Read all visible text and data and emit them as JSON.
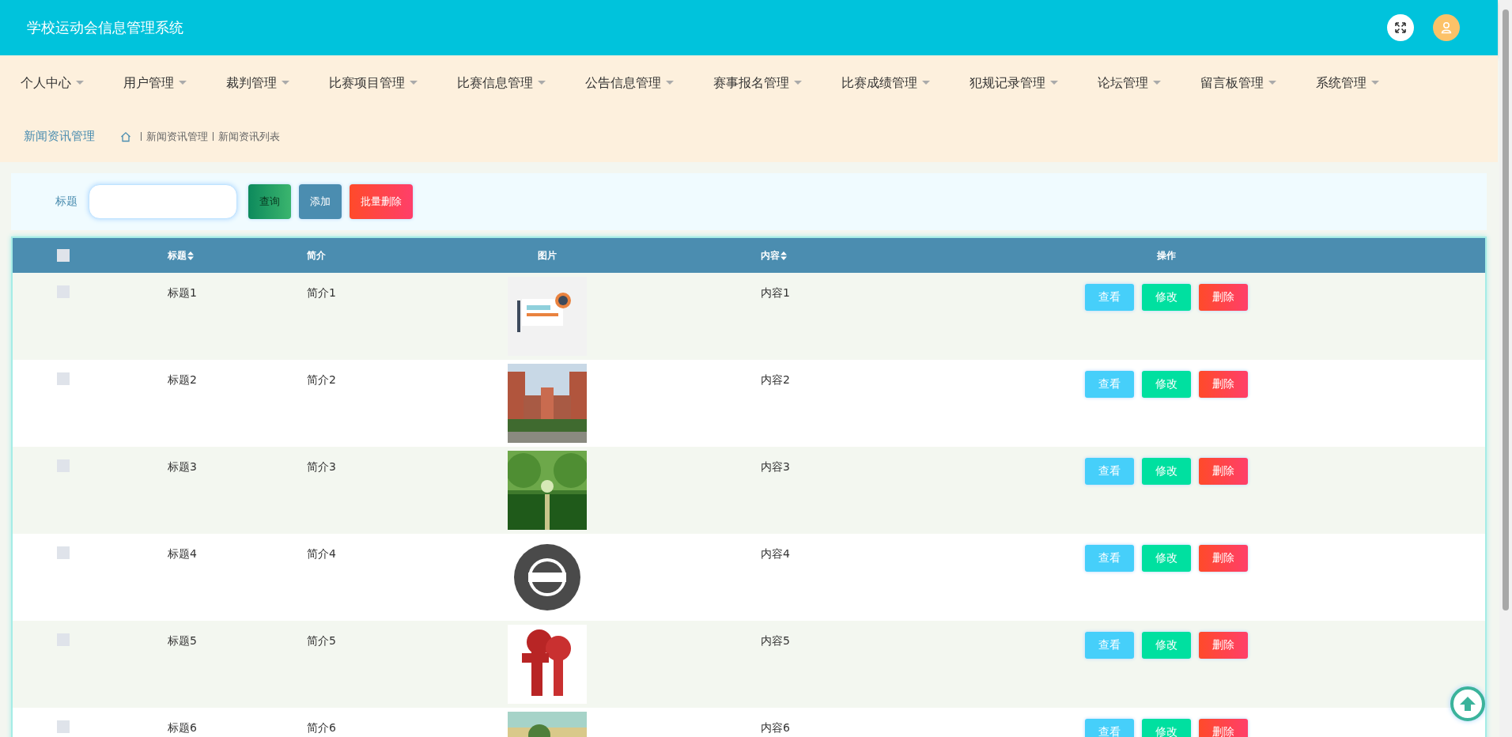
{
  "header": {
    "title": "学校运动会信息管理系统"
  },
  "nav": [
    {
      "label": "个人中心"
    },
    {
      "label": "用户管理"
    },
    {
      "label": "裁判管理"
    },
    {
      "label": "比赛项目管理"
    },
    {
      "label": "比赛信息管理"
    },
    {
      "label": "公告信息管理"
    },
    {
      "label": "赛事报名管理"
    },
    {
      "label": "比赛成绩管理"
    },
    {
      "label": "犯规记录管理"
    },
    {
      "label": "论坛管理"
    },
    {
      "label": "留言板管理"
    },
    {
      "label": "系统管理"
    }
  ],
  "breadcrumb": {
    "section": "新闻资讯管理",
    "path": [
      "新闻资讯管理",
      "新闻资讯列表"
    ]
  },
  "search": {
    "label": "标题",
    "buttons": [
      {
        "label": "查询",
        "kind": "search"
      },
      {
        "label": "添加",
        "kind": "add"
      },
      {
        "label": "批量删除",
        "kind": "delete"
      }
    ]
  },
  "table": {
    "all_checked": false,
    "columns": [
      {
        "label": "标题",
        "sortable": true
      },
      {
        "label": "简介",
        "sortable": false
      },
      {
        "label": "图片",
        "sortable": false
      },
      {
        "label": "内容",
        "sortable": true
      },
      {
        "label": "操作",
        "sortable": false
      }
    ],
    "rows": [
      {
        "checked": false,
        "title": "标题1",
        "summary": "简介1",
        "content": "内容1",
        "actions": [
          {
            "label": "查看",
            "kind": "view"
          },
          {
            "label": "修改",
            "kind": "edit"
          },
          {
            "label": "删除",
            "kind": "delete"
          }
        ]
      },
      {
        "checked": false,
        "title": "标题2",
        "summary": "简介2",
        "content": "内容2",
        "actions": [
          {
            "label": "查看",
            "kind": "view"
          },
          {
            "label": "修改",
            "kind": "edit"
          },
          {
            "label": "删除",
            "kind": "delete"
          }
        ]
      },
      {
        "checked": false,
        "title": "标题3",
        "summary": "简介3",
        "content": "内容3",
        "actions": [
          {
            "label": "查看",
            "kind": "view"
          },
          {
            "label": "修改",
            "kind": "edit"
          },
          {
            "label": "删除",
            "kind": "delete"
          }
        ]
      },
      {
        "checked": false,
        "title": "标题4",
        "summary": "简介4",
        "content": "内容4",
        "actions": [
          {
            "label": "查看",
            "kind": "view"
          },
          {
            "label": "修改",
            "kind": "edit"
          },
          {
            "label": "删除",
            "kind": "delete"
          }
        ]
      },
      {
        "checked": false,
        "title": "标题5",
        "summary": "简介5",
        "content": "内容5",
        "actions": [
          {
            "label": "查看",
            "kind": "view"
          },
          {
            "label": "修改",
            "kind": "edit"
          },
          {
            "label": "删除",
            "kind": "delete"
          }
        ]
      },
      {
        "checked": false,
        "title": "标题6",
        "summary": "简介6",
        "content": "内容6",
        "actions": [
          {
            "label": "查看",
            "kind": "view"
          },
          {
            "label": "修改",
            "kind": "edit"
          },
          {
            "label": "删除",
            "kind": "delete"
          }
        ]
      }
    ]
  }
}
